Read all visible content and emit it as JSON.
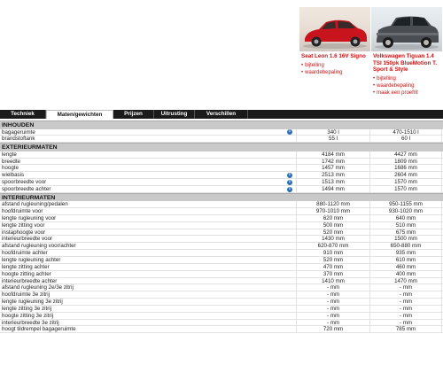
{
  "cars": [
    {
      "name": "Seat Leon 1.6 16V Signo",
      "links": [
        "bijtelling",
        "waardebepaling"
      ],
      "color": "#c8141c"
    },
    {
      "name": "Volkswagen Tiguan 1.4 TSI 150pk BlueMotion T. Sport & Style",
      "links": [
        "bijtelling",
        "waardebepaling",
        "maak een proefrit"
      ],
      "color": "#4a4e52"
    }
  ],
  "tabs": [
    {
      "label": "Techniek",
      "active": false
    },
    {
      "label": "Maten/gewichten",
      "active": true
    },
    {
      "label": "Prijzen",
      "active": false
    },
    {
      "label": "Uitrusting",
      "active": false
    },
    {
      "label": "Verschillen",
      "active": false
    }
  ],
  "sections": [
    {
      "title": "INHOUDEN",
      "rows": [
        {
          "label": "bagageruimte",
          "v1": "340 l",
          "v2": "470-1510 l",
          "info": true
        },
        {
          "label": "brandstoftank",
          "v1": "55 l",
          "v2": "60 l",
          "info": false
        }
      ]
    },
    {
      "title": "EXTERIEURMATEN",
      "rows": [
        {
          "label": "lengte",
          "v1": "4184 mm",
          "v2": "4427 mm",
          "info": false
        },
        {
          "label": "breedte",
          "v1": "1742 mm",
          "v2": "1809 mm",
          "info": false
        },
        {
          "label": "hoogte",
          "v1": "1457 mm",
          "v2": "1686 mm",
          "info": false
        },
        {
          "label": "wielbasis",
          "v1": "2513 mm",
          "v2": "2604 mm",
          "info": true
        },
        {
          "label": "spoorbreedte voor",
          "v1": "1513 mm",
          "v2": "1570 mm",
          "info": true
        },
        {
          "label": "spoorbreedte achter",
          "v1": "1494 mm",
          "v2": "1570 mm",
          "info": true
        }
      ]
    },
    {
      "title": "INTERIEURMATEN",
      "rows": [
        {
          "label": "afstand rugleuning/pedalen",
          "v1": "880-1120 mm",
          "v2": "950-1155 mm",
          "info": false
        },
        {
          "label": "hoofdruimte voor",
          "v1": "970-1010 mm",
          "v2": "930-1020 mm",
          "info": false
        },
        {
          "label": "lengte rugleuning voor",
          "v1": "620 mm",
          "v2": "640 mm",
          "info": false
        },
        {
          "label": "lengte zitting voor",
          "v1": "500 mm",
          "v2": "510 mm",
          "info": false
        },
        {
          "label": "instaphoogte voor",
          "v1": "520 mm",
          "v2": "675 mm",
          "info": false
        },
        {
          "label": "interieurbreedte voor",
          "v1": "1430 mm",
          "v2": "1500 mm",
          "info": false
        },
        {
          "label": "afstand rugleuning voor/achter",
          "v1": "620-870 mm",
          "v2": "650-880 mm",
          "info": false
        },
        {
          "label": "hoofdruimte achter",
          "v1": "910 mm",
          "v2": "935 mm",
          "info": false
        },
        {
          "label": "lengte rugleuning achter",
          "v1": "520 mm",
          "v2": "610 mm",
          "info": false
        },
        {
          "label": "lengte zitting achter",
          "v1": "470 mm",
          "v2": "460 mm",
          "info": false
        },
        {
          "label": "hoogte zitting achter",
          "v1": "370 mm",
          "v2": "400 mm",
          "info": false
        },
        {
          "label": "interieurbreedte achter",
          "v1": "1410 mm",
          "v2": "1470 mm",
          "info": false
        },
        {
          "label": "afstand rugleuning 2e/3e zitrij",
          "v1": "- mm",
          "v2": "- mm",
          "info": false
        },
        {
          "label": "hoofdruimte 3e zitrij",
          "v1": "- mm",
          "v2": "- mm",
          "info": false
        },
        {
          "label": "lengte rugleuning 3e zitrij",
          "v1": "- mm",
          "v2": "- mm",
          "info": false
        },
        {
          "label": "lengte zitting 3e zitrij",
          "v1": "- mm",
          "v2": "- mm",
          "info": false
        },
        {
          "label": "hoogte zitting 3e zitrij",
          "v1": "- mm",
          "v2": "- mm",
          "info": false
        },
        {
          "label": "interieurbreedte 3e zitrij",
          "v1": "- mm",
          "v2": "- mm",
          "info": false
        },
        {
          "label": "hoogt tildrempel bagageruimte",
          "v1": "720 mm",
          "v2": "785 mm",
          "info": false
        }
      ]
    }
  ]
}
